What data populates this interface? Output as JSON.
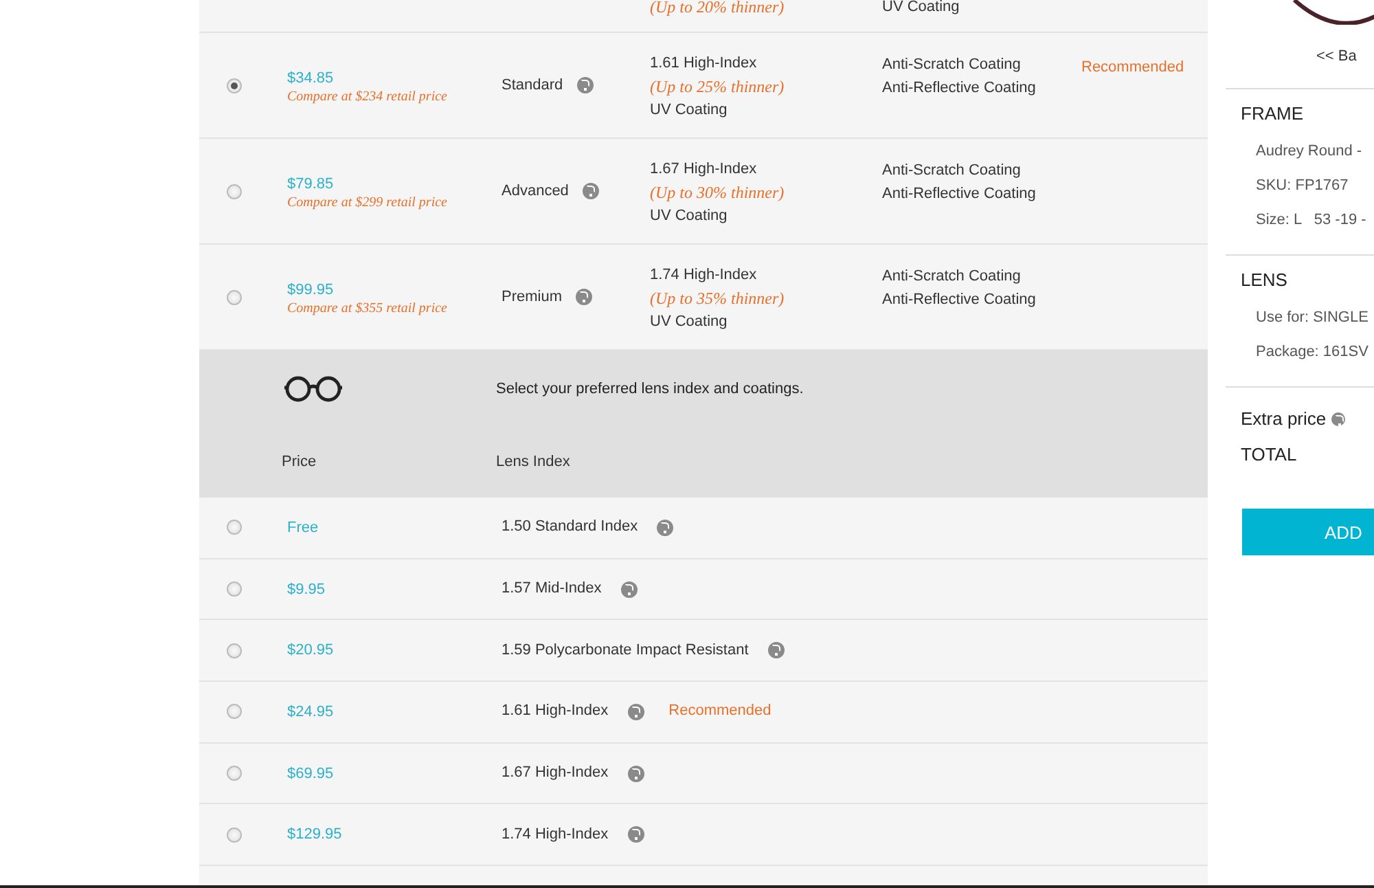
{
  "packages": {
    "partial_row": {
      "thinner": "(Up to 20% thinner)",
      "coating": "UV Coating"
    },
    "rows": [
      {
        "selected": true,
        "price": "$34.85",
        "compare": "Compare at $234 retail price",
        "tier": "Standard",
        "index": "1.61 High-Index",
        "thinner": "(Up to 25% thinner)",
        "uv": "UV Coating",
        "coatings": [
          "Anti-Scratch Coating",
          "Anti-Reflective Coating"
        ],
        "badge": "Recommended"
      },
      {
        "selected": false,
        "price": "$79.85",
        "compare": "Compare at $299 retail price",
        "tier": "Advanced",
        "index": "1.67 High-Index",
        "thinner": "(Up to 30% thinner)",
        "uv": "UV Coating",
        "coatings": [
          "Anti-Scratch Coating",
          "Anti-Reflective Coating"
        ]
      },
      {
        "selected": false,
        "price": "$99.95",
        "compare": "Compare at $355 retail price",
        "tier": "Premium",
        "index": "1.74 High-Index",
        "thinner": "(Up to 35% thinner)",
        "uv": "UV Coating",
        "coatings": [
          "Anti-Scratch Coating",
          "Anti-Reflective Coating"
        ]
      }
    ]
  },
  "index_section": {
    "prompt": "Select your preferred lens index and coatings.",
    "columns": [
      "Price",
      "Lens Index"
    ],
    "rows": [
      {
        "selected": false,
        "price": "Free",
        "index": "1.50 Standard Index"
      },
      {
        "selected": false,
        "price": "$9.95",
        "index": "1.57 Mid-Index"
      },
      {
        "selected": false,
        "price": "$20.95",
        "index": "1.59 Polycarbonate Impact Resistant"
      },
      {
        "selected": false,
        "price": "$24.95",
        "index": "1.61 High-Index",
        "badge": "Recommended"
      },
      {
        "selected": false,
        "price": "$69.95",
        "index": "1.67 High-Index"
      },
      {
        "selected": false,
        "price": "$129.95",
        "index": "1.74 High-Index"
      }
    ]
  },
  "summary": {
    "back_link": "<< Ba",
    "sections": [
      {
        "title": "FRAME",
        "lines": [
          "Audrey Round -",
          "SKU: FP1767",
          "Size: L   53 -19 -"
        ]
      },
      {
        "title": "LENS",
        "lines": [
          "Use for: SINGLE",
          "Package: 161SV"
        ]
      }
    ],
    "extra_price": "Extra price",
    "total": "TOTAL",
    "button": "ADD"
  }
}
